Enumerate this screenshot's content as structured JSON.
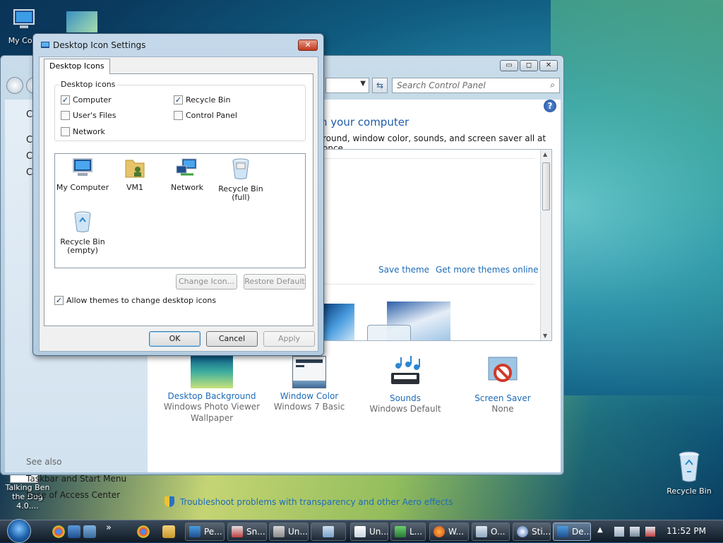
{
  "desktop": {
    "icons": [
      {
        "label": "My Com"
      },
      {
        "label": "Talking Ben the Dog 4.0...."
      },
      {
        "label": "Recycle Bin"
      }
    ]
  },
  "control_panel": {
    "search_placeholder": "Search Control Panel",
    "heading_partial": "n your computer",
    "description_partial": "round, window color, sounds, and screen saver all at once.",
    "left_stubs": [
      "C",
      "C",
      "C",
      "C"
    ],
    "see_also": "See also",
    "left_links": [
      "Taskbar and Start Menu",
      "Ease of Access Center"
    ],
    "theme_links": {
      "save": "Save theme",
      "more": "Get more themes online"
    },
    "items": [
      {
        "title": "Desktop Background",
        "sub1": "Windows Photo Viewer",
        "sub2": "Wallpaper"
      },
      {
        "title": "Window Color",
        "sub1": "Windows 7 Basic",
        "sub2": ""
      },
      {
        "title": "Sounds",
        "sub1": "Windows Default",
        "sub2": ""
      },
      {
        "title": "Screen Saver",
        "sub1": "None",
        "sub2": ""
      }
    ],
    "troubleshoot": "Troubleshoot problems with transparency and other Aero effects"
  },
  "dialog": {
    "title": "Desktop Icon Settings",
    "close_glyph": "✕",
    "tab": "Desktop Icons",
    "group_label": "Desktop icons",
    "checkboxes": [
      {
        "label": "Computer",
        "checked": true
      },
      {
        "label": "Recycle Bin",
        "checked": true
      },
      {
        "label": "User's Files",
        "checked": false
      },
      {
        "label": "Control Panel",
        "checked": false
      },
      {
        "label": "Network",
        "checked": false
      }
    ],
    "icons": [
      {
        "label": "My Computer",
        "label2": ""
      },
      {
        "label": "VM1",
        "label2": ""
      },
      {
        "label": "Network",
        "label2": ""
      },
      {
        "label": "Recycle Bin",
        "label2": "(full)"
      },
      {
        "label": "Recycle Bin",
        "label2": "(empty)"
      }
    ],
    "change_icon": "Change Icon...",
    "restore_default": "Restore Default",
    "allow_themes": {
      "label": "Allow themes to change desktop icons",
      "checked": true
    },
    "ok": "OK",
    "cancel": "Cancel",
    "apply": "Apply"
  },
  "taskbar": {
    "buttons": [
      "Pe...",
      "Sn...",
      "Un...",
      "",
      "Un...",
      "L...",
      "W...",
      "O...",
      "Sti...",
      "De..."
    ],
    "clock": "11:52 PM",
    "overflow": "»"
  },
  "colors": {
    "link": "#1e6bb8",
    "dialog_frame": "#b2cbe0",
    "close_red": "#c0391f"
  }
}
